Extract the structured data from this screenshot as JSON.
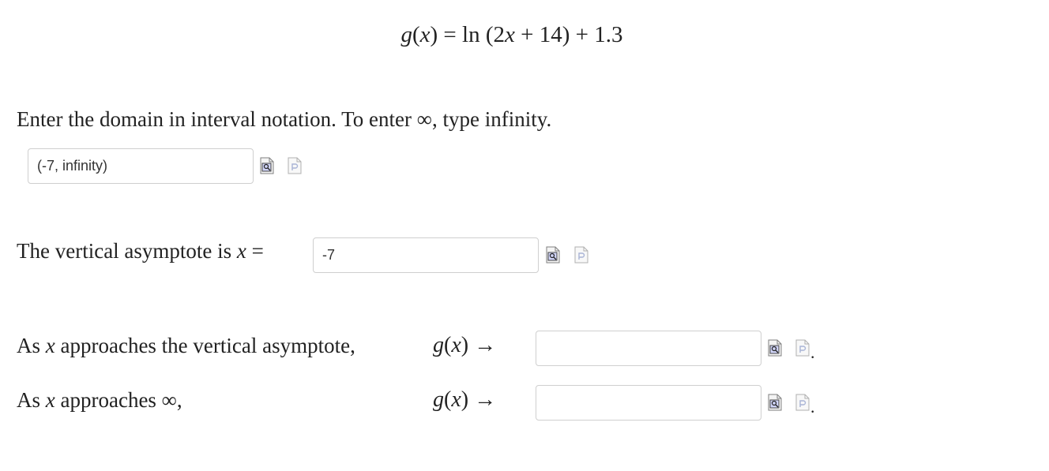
{
  "equation": {
    "lhs_func": "g",
    "lhs_var": "x",
    "rhs_fn": "ln",
    "rhs_inner_coef": "2",
    "rhs_inner_var": "x",
    "rhs_inner_rest": "+ 14",
    "rhs_rest": "+ 1.3"
  },
  "domain": {
    "prompt": "Enter the domain in interval notation. To enter ∞, type infinity.",
    "value": "(-7, infinity)"
  },
  "asymptote": {
    "prompt_text": "The vertical asymptote is",
    "var": "x",
    "eq": "=",
    "value": "-7"
  },
  "limits": [
    {
      "prompt_pre": "As",
      "var": "x",
      "prompt_post": "approaches the vertical asymptote,",
      "func": "g",
      "arrow": "→",
      "value": ""
    },
    {
      "prompt_pre": "As",
      "var": "x",
      "prompt_post": "approaches ∞,",
      "func": "g",
      "arrow": "→",
      "value": ""
    }
  ],
  "icons": {
    "preview": "preview-icon",
    "help": "help-icon"
  }
}
